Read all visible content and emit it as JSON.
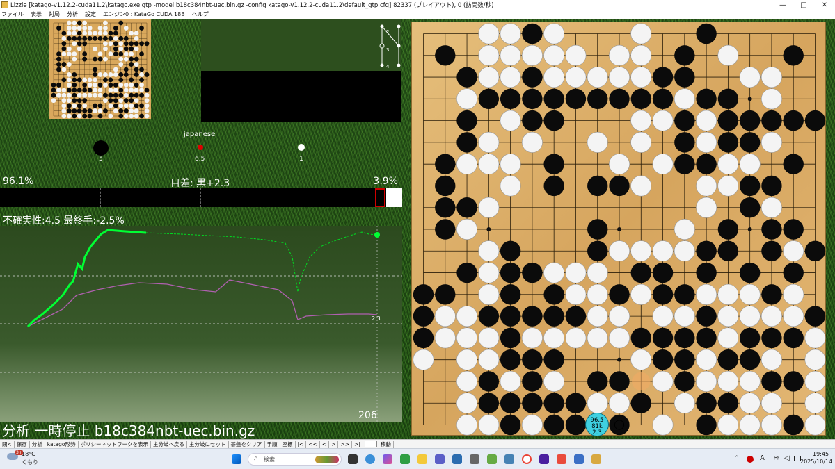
{
  "window": {
    "title": "Lizzie [katago-v1.12.2-cuda11.2\\katago.exe gtp -model b18c384nbt-uec.bin.gz -config katago-v1.12.2-cuda11.2\\default_gtp.cfg] 82337 (プレイアウト), 0 (訪問数/秒)",
    "minimize": "—",
    "maximize": "□",
    "close": "✕"
  },
  "menu": [
    "ファイル",
    "表示",
    "対局",
    "分析",
    "設定",
    "エンジン0 : KataGo CUDA 18B",
    "ヘルプ"
  ],
  "variation": {
    "labels": [
      "2",
      "3",
      "4"
    ]
  },
  "game_info": {
    "rules": "japanese",
    "black_captures": "5",
    "komi": "6.5",
    "white_captures": "1"
  },
  "winrate": {
    "black": "96.1%",
    "white": "3.9%",
    "score_label": "目差: 黒+2.3",
    "black_fraction": 0.961
  },
  "uncertainty": "不確実性:4.5 最終手:-2.5%",
  "graph": {
    "score_tag": "2.3",
    "move_number": "206"
  },
  "status": "分析 一時停止 b18c384nbt-uec.bin.gz",
  "suggest": {
    "winrate": "96.5",
    "visits": "81k",
    "score": "2.3"
  },
  "toolbar": [
    "閉<",
    "保存",
    "分析",
    "katago形勢",
    "ポリシーネットワークを表示",
    "主分岐へ戻る",
    "主分岐にセット",
    "碁盤をクリア",
    "手順",
    "座標",
    "|<",
    "<<",
    "<",
    ">",
    ">>",
    ">|",
    "",
    "移動"
  ],
  "taskbar": {
    "weather_temp": "18°C",
    "weather_desc": "くもり",
    "weather_badge": "3+",
    "search_placeholder": "検索",
    "time": "19:45",
    "date": "2025/10/14",
    "lang": "A"
  },
  "colors": {
    "black_win": "#00ff33",
    "score_line": "#b060b0"
  }
}
